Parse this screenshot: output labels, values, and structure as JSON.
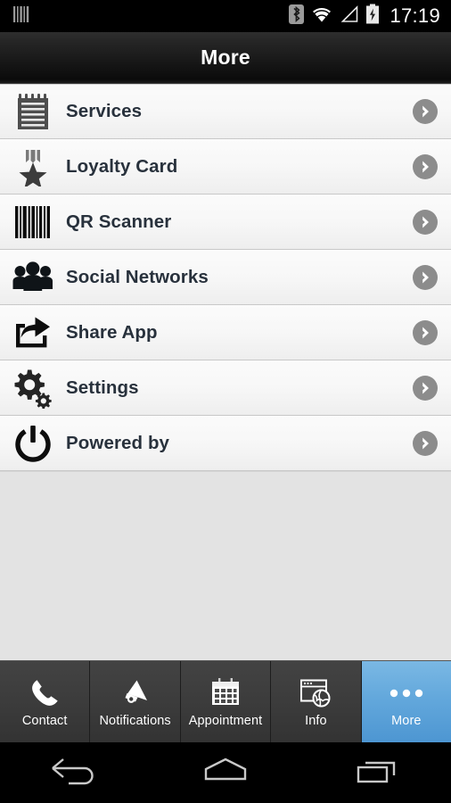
{
  "status_bar": {
    "left_icon": "barcode-icon",
    "icons": [
      "bluetooth-icon",
      "wifi-icon",
      "signal-icon",
      "battery-charging-icon"
    ],
    "time": "17:19"
  },
  "title_bar": {
    "title": "More"
  },
  "menu": {
    "items": [
      {
        "label": "Services",
        "icon": "notepad-icon",
        "chevron": "chevron-right-icon"
      },
      {
        "label": "Loyalty Card",
        "icon": "medal-icon",
        "chevron": "chevron-right-icon"
      },
      {
        "label": "QR Scanner",
        "icon": "barcode-icon",
        "chevron": "chevron-right-icon"
      },
      {
        "label": "Social Networks",
        "icon": "people-icon",
        "chevron": "chevron-right-icon"
      },
      {
        "label": "Share App",
        "icon": "share-icon",
        "chevron": "chevron-right-icon"
      },
      {
        "label": "Settings",
        "icon": "gears-icon",
        "chevron": "chevron-right-icon"
      },
      {
        "label": "Powered by",
        "icon": "power-icon",
        "chevron": "chevron-right-icon"
      }
    ]
  },
  "tab_bar": {
    "active_index": 4,
    "tabs": [
      {
        "label": "Contact",
        "icon": "phone-icon"
      },
      {
        "label": "Notifications",
        "icon": "megaphone-icon"
      },
      {
        "label": "Appointment",
        "icon": "calendar-icon"
      },
      {
        "label": "Info",
        "icon": "browser-globe-icon"
      },
      {
        "label": "More",
        "icon": "ellipsis-icon"
      }
    ]
  },
  "nav_bar": {
    "buttons": [
      {
        "name": "back-button",
        "icon": "back-arrow-icon"
      },
      {
        "name": "home-button",
        "icon": "home-icon"
      },
      {
        "name": "recents-button",
        "icon": "recents-icon"
      }
    ]
  },
  "colors": {
    "accent": "#5ba3d9",
    "row_text": "#28313c",
    "chevron": "#8c8c8c",
    "background": "#e3e3e3"
  }
}
